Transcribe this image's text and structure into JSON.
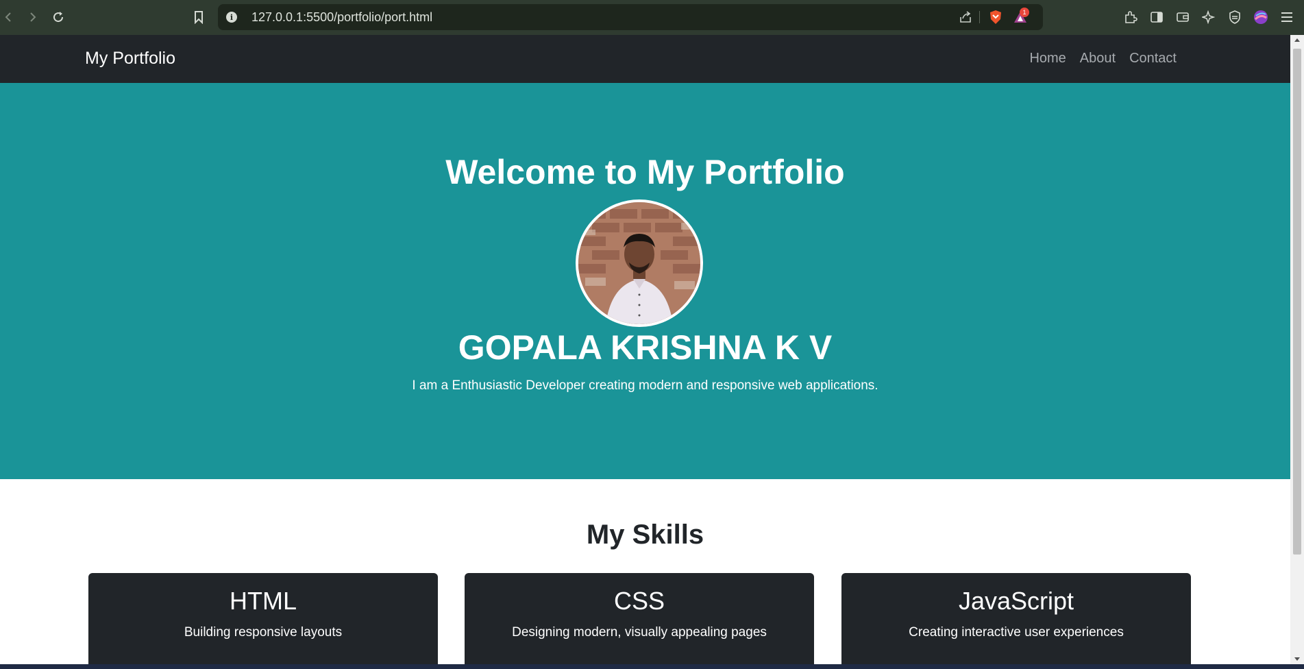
{
  "browser": {
    "url": "127.0.0.1:5500/portfolio/port.html",
    "notification_count": "1",
    "icons": [
      "back-icon",
      "forward-icon",
      "reload-icon",
      "bookmark-icon",
      "site-info-icon",
      "share-icon",
      "brave-shield-icon",
      "brave-rewards-icon",
      "extensions-icon",
      "sidebar-icon",
      "wallet-icon",
      "leo-ai-icon",
      "vpn-icon",
      "profile-icon",
      "menu-icon"
    ],
    "colors": {
      "toolbar": "#2f3b30",
      "urlbar": "#1e261d",
      "badge": "#e8463b"
    }
  },
  "navbar": {
    "brand": "My Portfolio",
    "links": [
      "Home",
      "About",
      "Contact"
    ]
  },
  "hero": {
    "title": "Welcome to My Portfolio",
    "name": "GOPALA KRISHNA K V",
    "subtitle": "I am a Enthusiastic Developer creating modern and responsive web applications."
  },
  "skills": {
    "title": "My Skills",
    "cards": [
      {
        "title": "HTML",
        "desc": "Building responsive layouts"
      },
      {
        "title": "CSS",
        "desc": "Designing modern, visually appealing pages"
      },
      {
        "title": "JavaScript",
        "desc": "Creating interactive user experiences"
      }
    ]
  },
  "colors": {
    "navbar_bg": "#212529",
    "hero_bg": "#1a9498",
    "card_bg": "#212529",
    "nav_link": "#a7abaf"
  }
}
